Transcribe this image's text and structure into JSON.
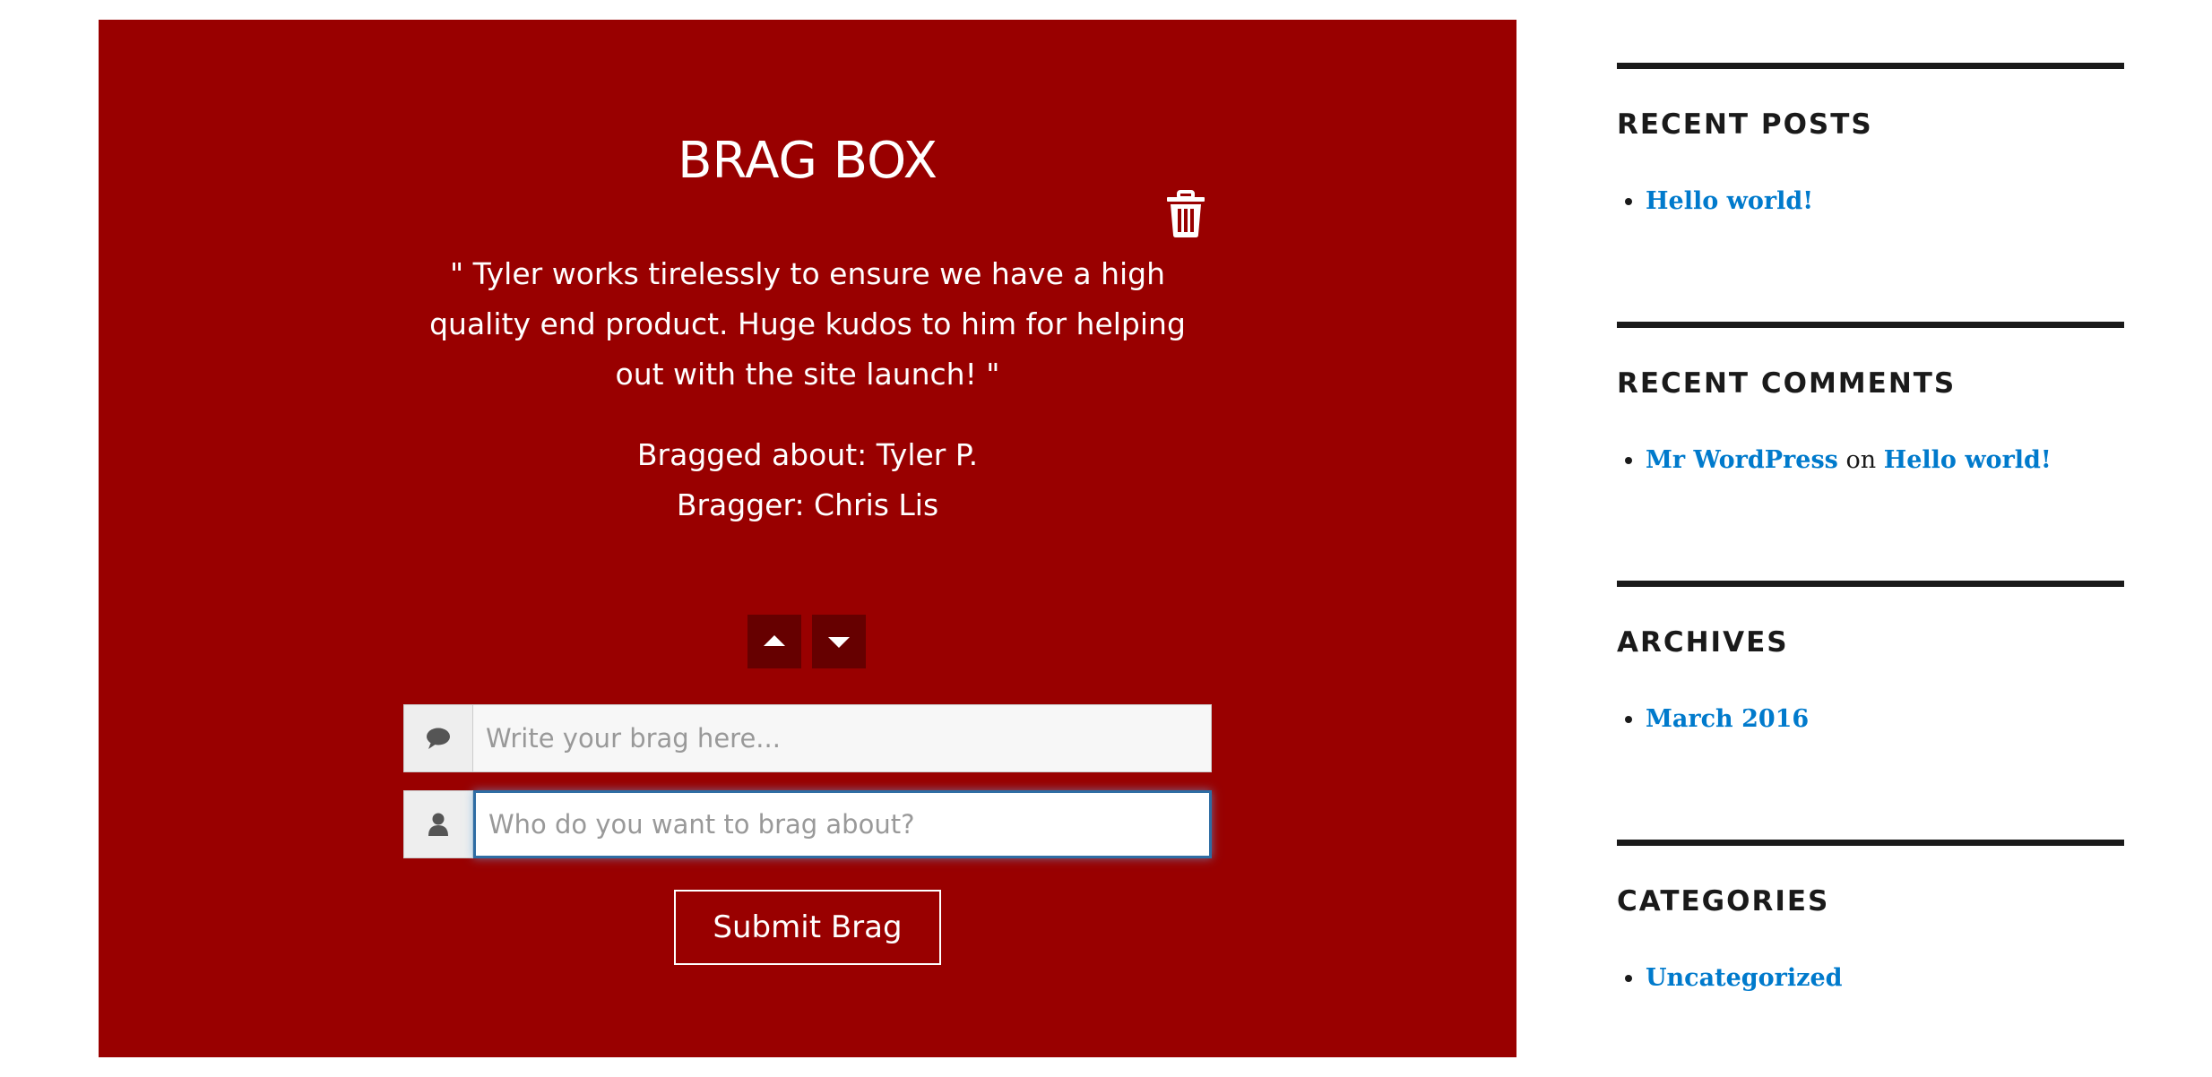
{
  "brag_box": {
    "title": "BRAG BOX",
    "quote": "\" Tyler works tirelessly to ensure we have a high quality end product. Huge kudos to him for helping out with the site launch! \"",
    "bragged_about": "Bragged about: Tyler P.",
    "bragger": "Bragger: Chris Lis",
    "brag_input_placeholder": "Write your brag here...",
    "who_input_placeholder": "Who do you want to brag about?",
    "submit_label": "Submit Brag",
    "background_color": "#990000",
    "icons": {
      "delete": "trash-icon",
      "upvote": "caret-up-icon",
      "downvote": "caret-down-icon",
      "brag_addon": "comment-icon",
      "who_addon": "user-icon"
    }
  },
  "sidebar": {
    "recent_posts": {
      "title": "RECENT POSTS",
      "items": [
        "Hello world!"
      ]
    },
    "recent_comments": {
      "title": "RECENT COMMENTS",
      "author": "Mr WordPress",
      "connector": "on",
      "post": "Hello world!"
    },
    "archives": {
      "title": "ARCHIVES",
      "items": [
        "March 2016"
      ]
    },
    "categories": {
      "title": "CATEGORIES",
      "items": [
        "Uncategorized"
      ]
    },
    "link_color": "#007acc"
  }
}
